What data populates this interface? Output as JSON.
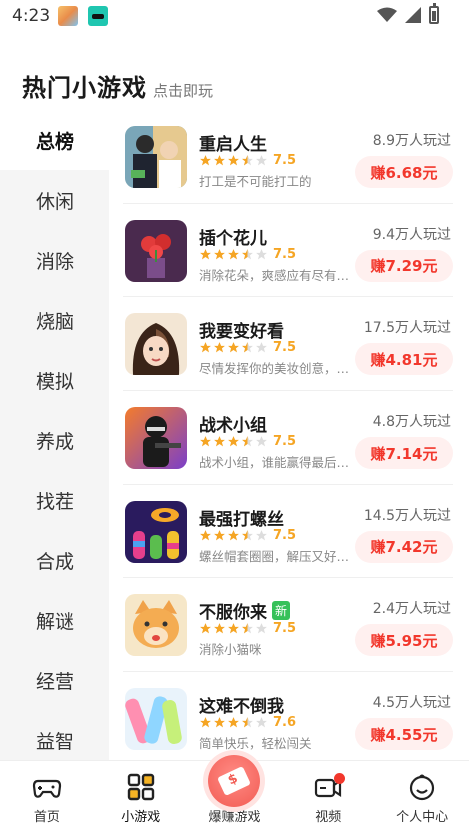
{
  "status_bar": {
    "time": "4:23"
  },
  "header": {
    "title": "热门小游戏",
    "subtitle": "点击即玩"
  },
  "sidebar": {
    "items": [
      {
        "label": "总榜",
        "active": true
      },
      {
        "label": "休闲"
      },
      {
        "label": "消除"
      },
      {
        "label": "烧脑"
      },
      {
        "label": "模拟"
      },
      {
        "label": "养成"
      },
      {
        "label": "找茬"
      },
      {
        "label": "合成"
      },
      {
        "label": "解谜"
      },
      {
        "label": "经营"
      },
      {
        "label": "益智"
      }
    ]
  },
  "games": [
    {
      "name": "重启人生",
      "rating": "7.5",
      "stars": 3.5,
      "desc": "打工是不可能打工的",
      "plays": "8.9万人玩过",
      "reward": "赚6.68元"
    },
    {
      "name": "插个花儿",
      "rating": "7.5",
      "stars": 3.5,
      "desc": "消除花朵，爽感应有尽有…",
      "plays": "9.4万人玩过",
      "reward": "赚7.29元"
    },
    {
      "name": "我要变好看",
      "rating": "7.5",
      "stars": 3.5,
      "desc": "尽情发挥你的美妆创意，…",
      "plays": "17.5万人玩过",
      "reward": "赚4.81元"
    },
    {
      "name": "战术小组",
      "rating": "7.5",
      "stars": 3.5,
      "desc": "战术小组，谁能赢得最后…",
      "plays": "4.8万人玩过",
      "reward": "赚7.14元"
    },
    {
      "name": "最强打螺丝",
      "rating": "7.5",
      "stars": 3.5,
      "desc": "螺丝帽套圈圈，解压又好…",
      "plays": "14.5万人玩过",
      "reward": "赚7.42元"
    },
    {
      "name": "不服你来",
      "badge": "新",
      "rating": "7.5",
      "stars": 3.5,
      "desc": "消除小猫咪",
      "plays": "2.4万人玩过",
      "reward": "赚5.95元"
    },
    {
      "name": "这难不倒我",
      "rating": "7.6",
      "stars": 3.5,
      "desc": "简单快乐，轻松闯关",
      "plays": "4.5万人玩过",
      "reward": "赚4.55元"
    }
  ],
  "bottom_nav": {
    "items": [
      {
        "label": "首页",
        "icon": "gamepad-icon"
      },
      {
        "label": "小游戏",
        "icon": "grid-icon",
        "active": true
      },
      {
        "label": "爆赚游戏",
        "icon": "money-card-icon"
      },
      {
        "label": "视频",
        "icon": "video-icon"
      },
      {
        "label": "个人中心",
        "icon": "smile-face-icon"
      }
    ]
  },
  "colors": {
    "accent_red": "#f2372c",
    "star": "#f5a524",
    "new_badge": "#37c15a"
  }
}
